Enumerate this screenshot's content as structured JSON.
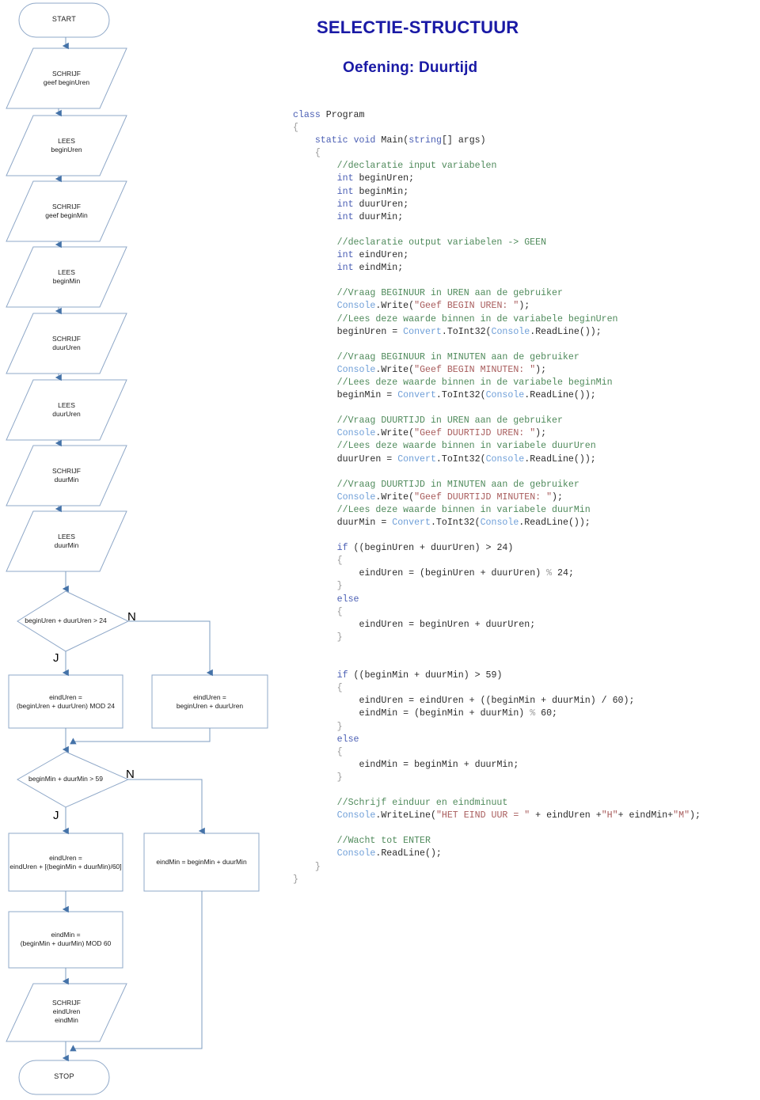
{
  "titles": {
    "main": "SELECTIE-STRUCTUUR",
    "sub": "Oefening: Duurtijd"
  },
  "flowchart": {
    "branch_yes": "J",
    "branch_no": "N",
    "nodes": [
      {
        "id": "start",
        "shape": "terminator",
        "lines": [
          "START"
        ]
      },
      {
        "id": "schrijf1",
        "shape": "parallelogram",
        "lines": [
          "SCHRIJF",
          "geef beginUren"
        ]
      },
      {
        "id": "lees1",
        "shape": "parallelogram",
        "lines": [
          "LEES",
          "beginUren"
        ]
      },
      {
        "id": "schrijf2",
        "shape": "parallelogram",
        "lines": [
          "SCHRIJF",
          "geef beginMin"
        ]
      },
      {
        "id": "lees2",
        "shape": "parallelogram",
        "lines": [
          "LEES",
          "beginMin"
        ]
      },
      {
        "id": "schrijf3",
        "shape": "parallelogram",
        "lines": [
          "SCHRIJF",
          "duurUren"
        ]
      },
      {
        "id": "lees3",
        "shape": "parallelogram",
        "lines": [
          "LEES",
          "duurUren"
        ]
      },
      {
        "id": "schrijf4",
        "shape": "parallelogram",
        "lines": [
          "SCHRIJF",
          "duurMin"
        ]
      },
      {
        "id": "lees4",
        "shape": "parallelogram",
        "lines": [
          "LEES",
          "duurMin"
        ]
      },
      {
        "id": "decision1",
        "shape": "diamond",
        "lines": [
          "beginUren + duurUren > 24"
        ]
      },
      {
        "id": "proc1-yes",
        "shape": "process",
        "lines": [
          "eindUren =",
          "(beginUren + duurUren) MOD 24"
        ]
      },
      {
        "id": "proc1-no",
        "shape": "process",
        "lines": [
          "eindUren =",
          "beginUren + duurUren"
        ]
      },
      {
        "id": "decision2",
        "shape": "diamond",
        "lines": [
          "beginMin + duurMin > 59"
        ]
      },
      {
        "id": "proc2-yes",
        "shape": "process",
        "lines": [
          "eindUren =",
          "eindUren + [(beginMin + duurMin)/60]"
        ]
      },
      {
        "id": "proc2-no",
        "shape": "process",
        "lines": [
          "eindMin = beginMin + duurMin"
        ]
      },
      {
        "id": "proc3",
        "shape": "process",
        "lines": [
          "eindMin =",
          "(beginMin + duurMin) MOD 60"
        ]
      },
      {
        "id": "schrijf5",
        "shape": "parallelogram",
        "lines": [
          "SCHRIJF",
          "eindUren",
          "eindMin"
        ]
      },
      {
        "id": "stop",
        "shape": "terminator",
        "lines": [
          "STOP"
        ]
      }
    ]
  },
  "code": {
    "language": "csharp",
    "lines": [
      "class Program",
      "{",
      "    static void Main(string[] args)",
      "    {",
      "        //declaratie input variabelen",
      "        int beginUren;",
      "        int beginMin;",
      "        int duurUren;",
      "        int duurMin;",
      "",
      "        //declaratie output variabelen -> GEEN",
      "        int eindUren;",
      "        int eindMin;",
      "",
      "        //Vraag BEGINUUR in UREN aan de gebruiker",
      "        Console.Write(\"Geef BEGIN UREN: \");",
      "        //Lees deze waarde binnen in de variabele beginUren",
      "        beginUren = Convert.ToInt32(Console.ReadLine());",
      "",
      "        //Vraag BEGINUUR in MINUTEN aan de gebruiker",
      "        Console.Write(\"Geef BEGIN MINUTEN: \");",
      "        //Lees deze waarde binnen in de variabele beginMin",
      "        beginMin = Convert.ToInt32(Console.ReadLine());",
      "",
      "        //Vraag DUURTIJD in UREN aan de gebruiker",
      "        Console.Write(\"Geef DUURTIJD UREN: \");",
      "        //Lees deze waarde binnen in variabele duurUren",
      "        duurUren = Convert.ToInt32(Console.ReadLine());",
      "",
      "        //Vraag DUURTIJD in MINUTEN aan de gebruiker",
      "        Console.Write(\"Geef DUURTIJD MINUTEN: \");",
      "        //Lees deze waarde binnen in variabele duurMin",
      "        duurMin = Convert.ToInt32(Console.ReadLine());",
      "",
      "        if ((beginUren + duurUren) > 24)",
      "        {",
      "            eindUren = (beginUren + duurUren) % 24;",
      "        }",
      "        else",
      "        {",
      "            eindUren = beginUren + duurUren;",
      "        }",
      "",
      "",
      "        if ((beginMin + duurMin) > 59)",
      "        {",
      "            eindUren = eindUren + ((beginMin + duurMin) / 60);",
      "            eindMin = (beginMin + duurMin) % 60;",
      "        }",
      "        else",
      "        {",
      "            eindMin = beginMin + duurMin;",
      "        }",
      "",
      "        //Schrijf einduur en eindminuut",
      "        Console.WriteLine(\"HET EIND UUR = \" + eindUren +\"H\"+ eindMin+\"M\");",
      "",
      "        //Wacht tot ENTER",
      "        Console.ReadLine();",
      "    }",
      "}"
    ]
  },
  "colors": {
    "title": "#1919a5",
    "shape_stroke": "#8fa8c8",
    "arrow": "#4472a8",
    "connector": "#7d9cc0",
    "comment": "#4f8a5b",
    "keyword": "#4b5fb4",
    "type": "#6f9fd8",
    "string": "#a85c5c"
  }
}
